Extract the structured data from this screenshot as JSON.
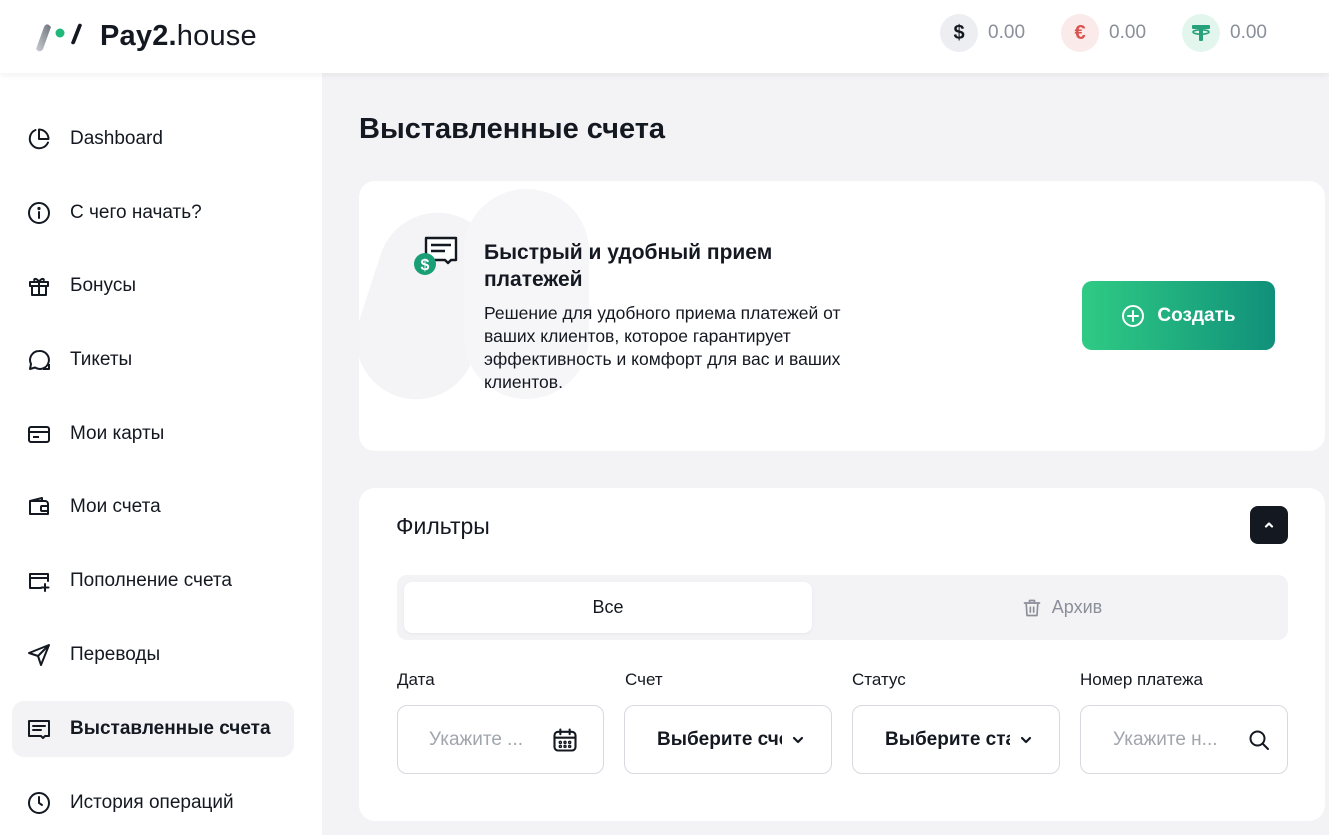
{
  "brand": {
    "name_bold": "Pay2.",
    "name_light": "house"
  },
  "balances": [
    {
      "currency": "usd",
      "icon": "dollar-icon",
      "symbol": "$",
      "value": "0.00"
    },
    {
      "currency": "eur",
      "icon": "euro-icon",
      "symbol": "€",
      "value": "0.00"
    },
    {
      "currency": "usdt",
      "icon": "tether-icon",
      "symbol": "₮",
      "value": "0.00"
    }
  ],
  "sidebar": {
    "items": [
      {
        "label": "Dashboard",
        "icon": "pie-chart-icon"
      },
      {
        "label": "С чего начать?",
        "icon": "info-icon"
      },
      {
        "label": "Бонусы",
        "icon": "gift-icon"
      },
      {
        "label": "Тикеты",
        "icon": "chat-icon"
      },
      {
        "label": "Мои карты",
        "icon": "cards-icon"
      },
      {
        "label": "Мои счета",
        "icon": "wallet-icon"
      },
      {
        "label": "Пополнение счета",
        "icon": "card-plus-icon"
      },
      {
        "label": "Переводы",
        "icon": "send-icon"
      },
      {
        "label": "Выставленные счета",
        "icon": "invoice-icon",
        "active": true
      },
      {
        "label": "История операций",
        "icon": "clock-icon"
      }
    ]
  },
  "main": {
    "title": "Выставленные счета",
    "promo": {
      "title": "Быстрый и удобный прием платежей",
      "text": "Решение для удобного приема платежей от ваших клиентов, которое гарантирует эффективность и комфорт для вас и ваших клиентов.",
      "button_label": "Создать"
    },
    "filters": {
      "title": "Фильтры",
      "tabs": {
        "all": "Все",
        "archive": "Архив"
      },
      "date": {
        "label": "Дата",
        "placeholder": "Укажите ..."
      },
      "account": {
        "label": "Счет",
        "value": "Выберите сче"
      },
      "status": {
        "label": "Статус",
        "value": "Выберите ста"
      },
      "payment_number": {
        "label": "Номер платежа",
        "placeholder": "Укажите н..."
      }
    }
  },
  "colors": {
    "accent_start": "#2fcb84",
    "accent_end": "#10907a",
    "dark": "#141821"
  }
}
